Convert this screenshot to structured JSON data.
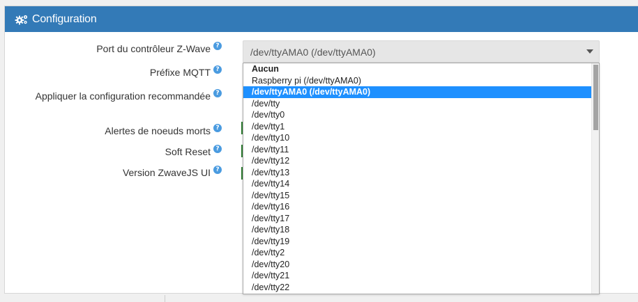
{
  "panel": {
    "title": "Configuration",
    "icon": "cogs-icon",
    "heading_color": "#337ab7"
  },
  "labels": [
    {
      "text": "Port du contrôleur Z-Wave",
      "help": "?"
    },
    {
      "text": "Préfixe MQTT",
      "help": "?"
    },
    {
      "text": "Appliquer la configuration recommandée",
      "help": "?"
    },
    {
      "text": "Alertes de noeuds morts",
      "help": "?"
    },
    {
      "text": "Soft Reset",
      "help": "?"
    },
    {
      "text": "Version ZwaveJS UI",
      "help": "?"
    }
  ],
  "port_select": {
    "value": "/dev/ttyAMA0 (/dev/ttyAMA0)",
    "options": [
      "Aucun",
      "Raspberry pi (/dev/ttyAMA0)",
      "/dev/ttyAMA0 (/dev/ttyAMA0)",
      "/dev/tty",
      "/dev/tty0",
      "/dev/tty1",
      "/dev/tty10",
      "/dev/tty11",
      "/dev/tty12",
      "/dev/tty13",
      "/dev/tty14",
      "/dev/tty15",
      "/dev/tty16",
      "/dev/tty17",
      "/dev/tty18",
      "/dev/tty19",
      "/dev/tty2",
      "/dev/tty20",
      "/dev/tty21",
      "/dev/tty22"
    ],
    "selected_index": 2,
    "highlight_color": "#1e90ff"
  }
}
